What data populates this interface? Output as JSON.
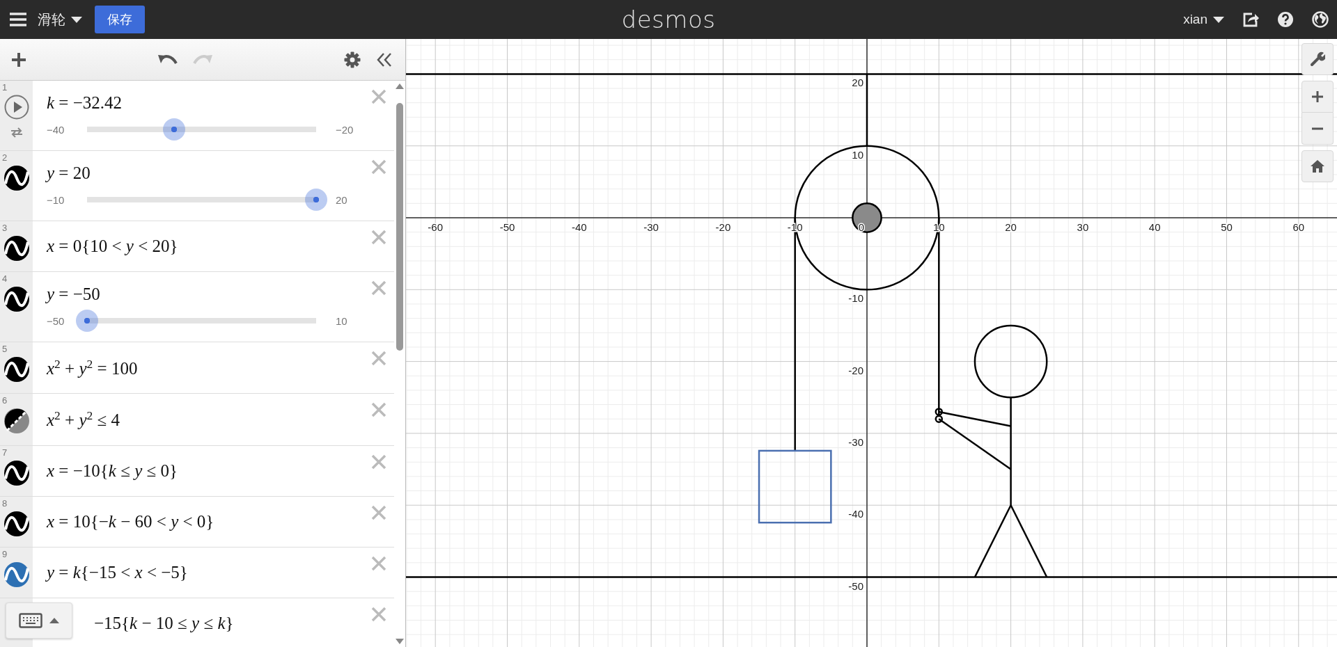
{
  "topbar": {
    "title": "滑轮",
    "save_label": "保存",
    "logo": "desmos",
    "user": "xian"
  },
  "expressions": [
    {
      "number": "1",
      "kind": "variable",
      "latex": "*k* = −32.42",
      "slider": {
        "min": "−40",
        "max": "−20",
        "level": 0.379
      }
    },
    {
      "number": "2",
      "kind": "curve",
      "color": "#000000",
      "latex": "*y* = 20",
      "slider": {
        "min": "−10",
        "max": "20",
        "level": 1
      }
    },
    {
      "number": "3",
      "kind": "curve",
      "color": "#000000",
      "latex": "*x* = 0{10 < *y* < 20}"
    },
    {
      "number": "4",
      "kind": "curve",
      "color": "#000000",
      "latex": "*y* = −50",
      "slider": {
        "min": "−50",
        "max": "10",
        "level": 0
      }
    },
    {
      "number": "5",
      "kind": "curve",
      "color": "#000000",
      "latex": "*x*$^{2}$ + *y*$^{2}$ = 100"
    },
    {
      "number": "6",
      "kind": "fill",
      "color": "#000000",
      "latex": "*x*$^{2}$ + *y*$^{2}$ ≤ 4"
    },
    {
      "number": "7",
      "kind": "curve",
      "color": "#000000",
      "latex": "*x* = −10{*k* ≤ *y* ≤ 0}"
    },
    {
      "number": "8",
      "kind": "curve",
      "color": "#000000",
      "latex": "*x* = 10{−*k* − 60 < *y* < 0}"
    },
    {
      "number": "9",
      "kind": "curve",
      "color": "#2d70b3",
      "latex": "*y* = *k*{−15 < *x* < −5}"
    },
    {
      "kind": "covered",
      "latex": "−15{*k* − 10 ≤ *y* ≤ *k*}"
    }
  ],
  "graph": {
    "x_labels": [
      "-60",
      "-50",
      "-40",
      "-30",
      "-20",
      "-10",
      "0",
      "10",
      "20",
      "30",
      "40",
      "50",
      "60"
    ],
    "y_labels": [
      "20",
      "10",
      "-10",
      "-20",
      "-30",
      "-40",
      "-50"
    ]
  }
}
